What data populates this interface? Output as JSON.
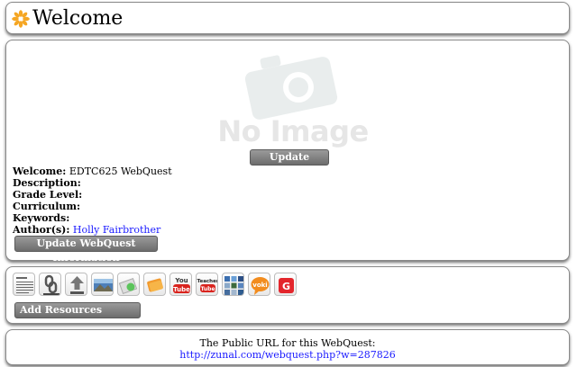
{
  "header": {
    "title": "Welcome",
    "icon": "flower-icon",
    "icon_color": "#f5a623"
  },
  "info": {
    "no_image_text": "No Image",
    "update_image_label": "Update Image",
    "fields": [
      {
        "label": "Welcome:",
        "value": "EDTC625 WebQuest"
      },
      {
        "label": "Description:",
        "value": ""
      },
      {
        "label": "Grade Level:",
        "value": ""
      },
      {
        "label": "Curriculum:",
        "value": ""
      },
      {
        "label": "Keywords:",
        "value": ""
      },
      {
        "label": "Author(s):",
        "value": "Holly Fairbrother"
      }
    ],
    "update_info_label": "Update WebQuest Information"
  },
  "resources": {
    "icons": [
      "text-icon",
      "link-icon",
      "upload-icon",
      "image-icon",
      "flash-icon",
      "folder-icon",
      "youtube-icon",
      "teachertube-icon",
      "gallery-icon",
      "voki-icon",
      "google-icon"
    ],
    "youtube_text": "You Tube",
    "teachertube_text": "Teacher Tube",
    "voki_text": "voki",
    "google_text": "G",
    "add_label": "Add Resources"
  },
  "public_url": {
    "caption": "The Public URL for this WebQuest:",
    "url": "http://zunal.com/webquest.php?w=287826"
  }
}
